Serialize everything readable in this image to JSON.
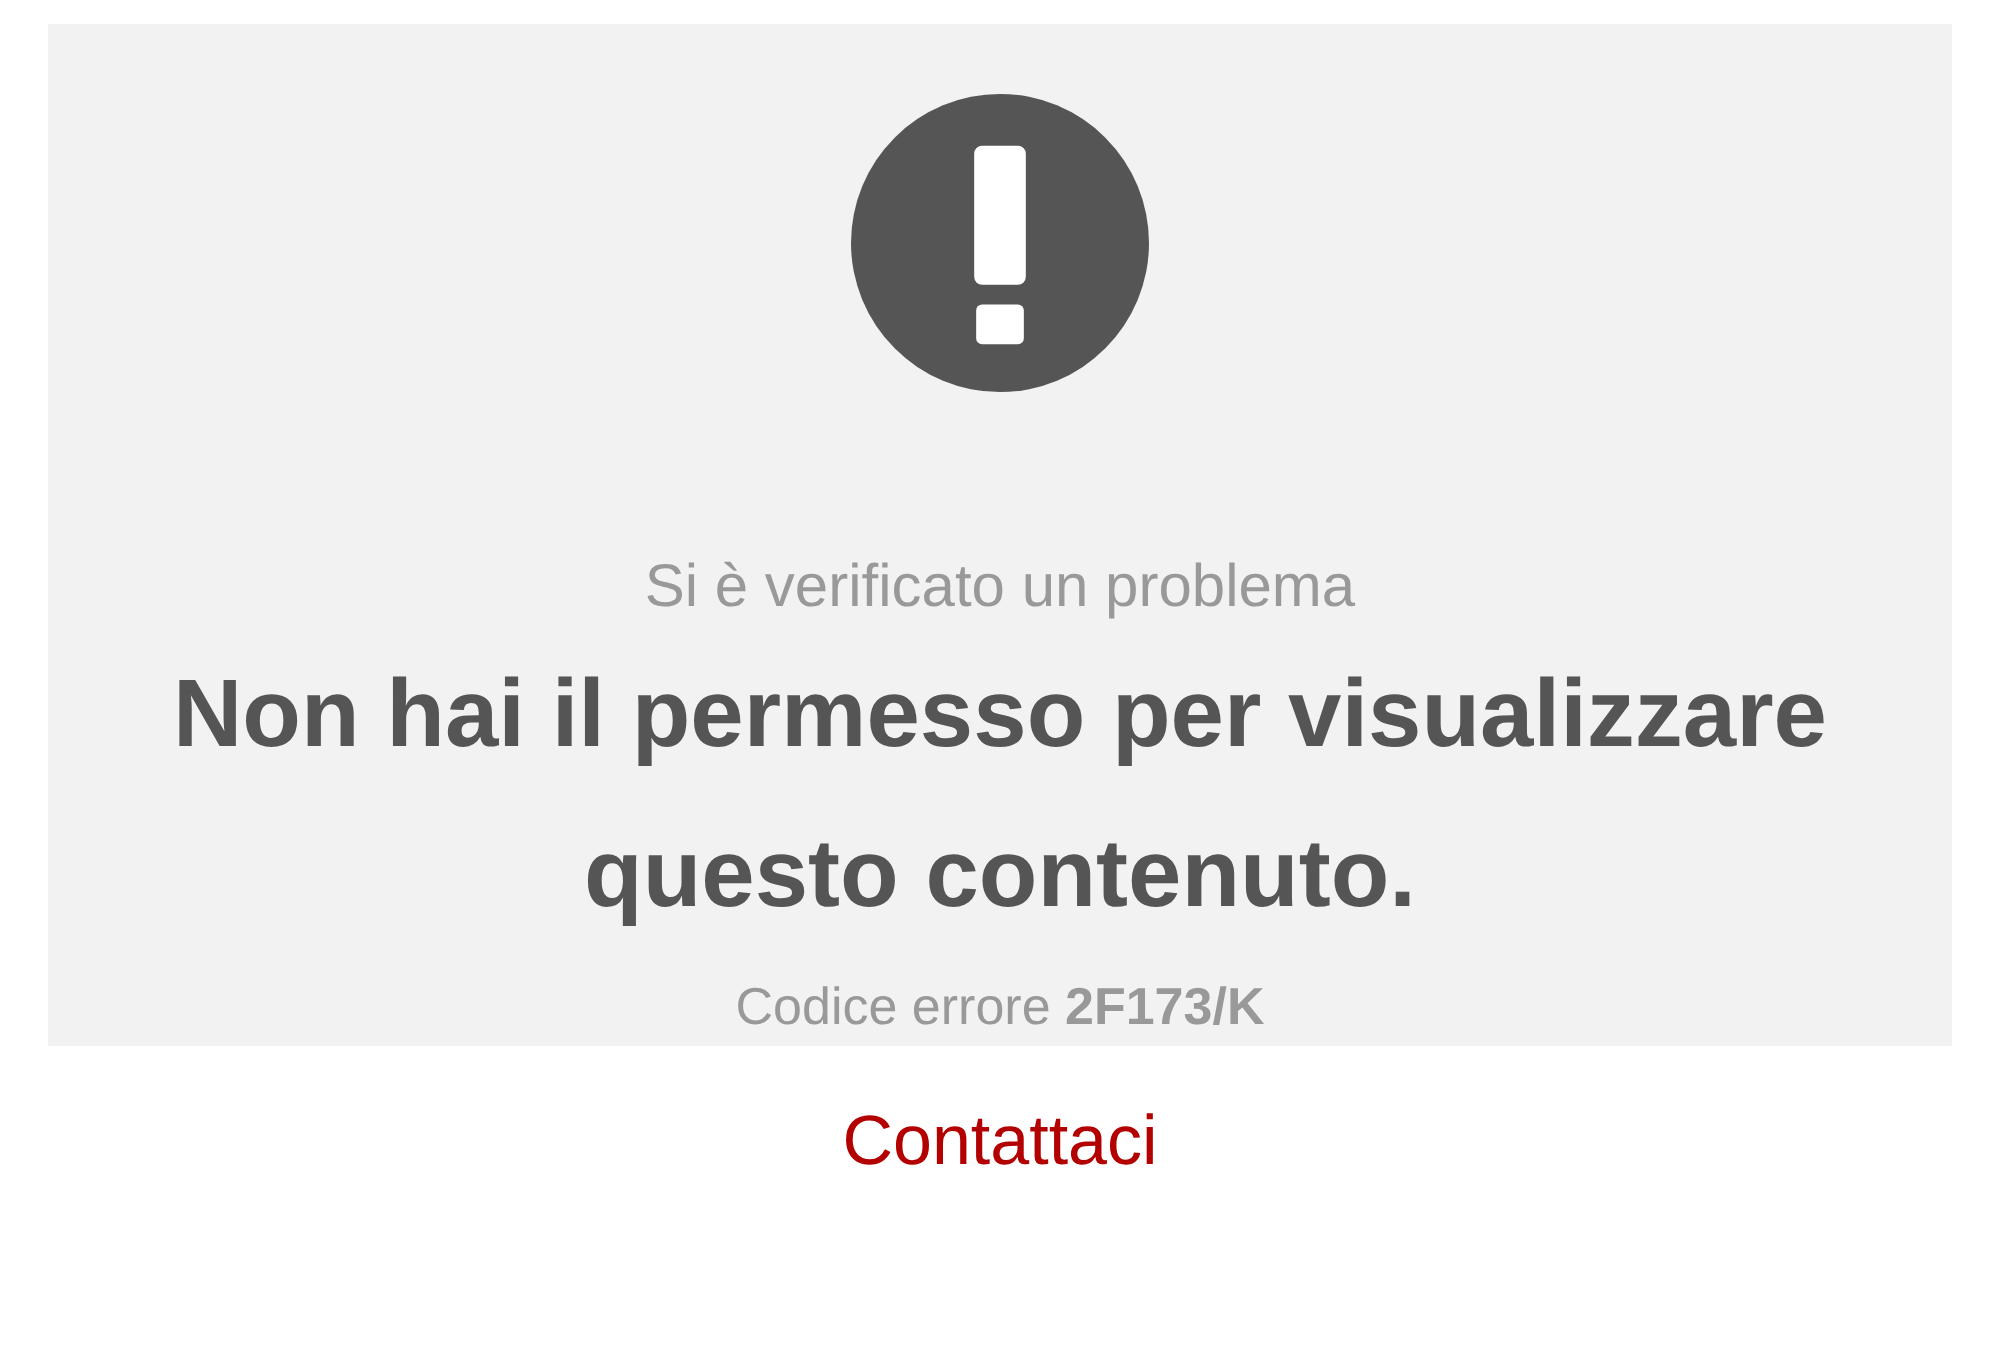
{
  "error_panel": {
    "subtitle": "Si è verificato un problema",
    "message": "Non hai il permesso per visualizzare questo contenuto.",
    "error_code": "Codice errore **2F173/K**"
  },
  "contact_link": {
    "label": "Contattaci"
  }
}
